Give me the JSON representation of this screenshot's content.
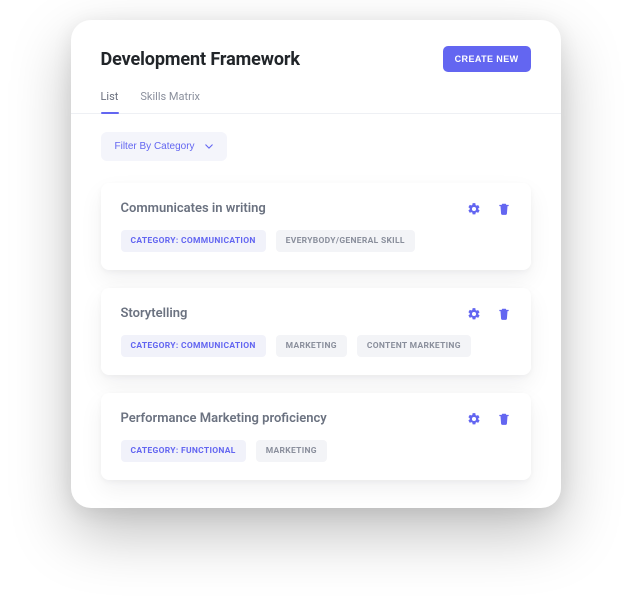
{
  "header": {
    "title": "Development Framework",
    "create_label": "CREATE NEW"
  },
  "tabs": [
    {
      "label": "List",
      "active": true
    },
    {
      "label": "Skills Matrix",
      "active": false
    }
  ],
  "filter": {
    "label": "Filter By Category"
  },
  "skills": [
    {
      "title": "Communicates in writing",
      "tags": [
        {
          "label": "CATEGORY: COMMUNICATION",
          "kind": "primary"
        },
        {
          "label": "EVERYBODY/GENERAL SKILL",
          "kind": "secondary"
        }
      ]
    },
    {
      "title": "Storytelling",
      "tags": [
        {
          "label": "CATEGORY: COMMUNICATION",
          "kind": "primary"
        },
        {
          "label": "MARKETING",
          "kind": "secondary"
        },
        {
          "label": "CONTENT MARKETING",
          "kind": "secondary"
        }
      ]
    },
    {
      "title": "Performance Marketing proficiency",
      "tags": [
        {
          "label": "CATEGORY: FUNCTIONAL",
          "kind": "primary"
        },
        {
          "label": "MARKETING",
          "kind": "secondary"
        }
      ]
    }
  ],
  "colors": {
    "accent": "#6366f1"
  }
}
